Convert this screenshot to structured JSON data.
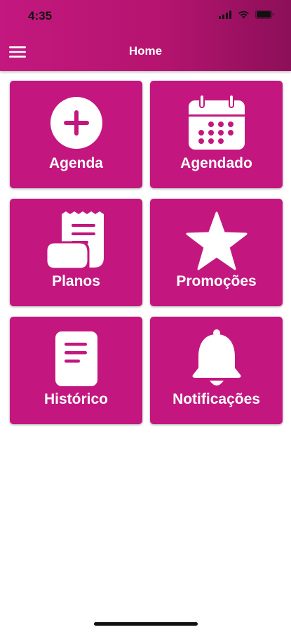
{
  "status_bar": {
    "time": "4:35"
  },
  "header": {
    "title": "Home",
    "menu_icon": "hamburger-menu-icon"
  },
  "tiles": [
    {
      "label": "Agenda",
      "icon": "add-circle-icon"
    },
    {
      "label": "Agendado",
      "icon": "calendar-icon"
    },
    {
      "label": "Planos",
      "icon": "receipt-scroll-icon"
    },
    {
      "label": "Promoções",
      "icon": "star-icon"
    },
    {
      "label": "Histórico",
      "icon": "document-icon"
    },
    {
      "label": "Notificações",
      "icon": "bell-icon"
    }
  ],
  "colors": {
    "brand": "#c3177f",
    "header_dark": "#8c0f59",
    "text_on_brand": "#ffffff"
  }
}
